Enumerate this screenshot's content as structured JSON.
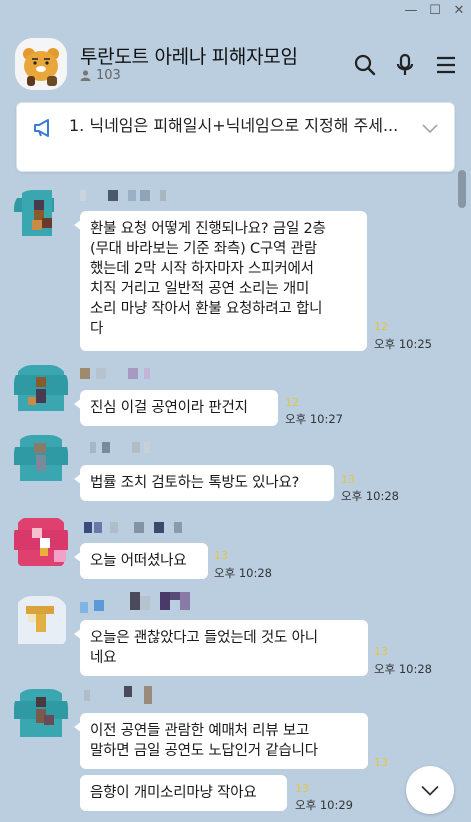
{
  "window": {
    "minimize": "—",
    "maximize": "☐",
    "close": "✕"
  },
  "header": {
    "title": "투란도트 아레나 피해자모임",
    "member_count": "103",
    "icons": [
      "search-icon",
      "microphone-icon",
      "menu-icon"
    ]
  },
  "notice": {
    "text": "1. 닉네임은 피해일시+닉네임으로 지정해 주세..."
  },
  "messages": [
    {
      "text_lines": [
        "환불 요청 어떻게 진행되나요? 금일 2층",
        "(무대 바라보는 기준 좌측)  C구역 관람",
        "했는데 2막 시작 하자마자 스피커에서",
        "치직 거리고 일반적 공연 소리는 개미",
        "소리 마냥 작아서 환불 요청하려고 합니",
        "다"
      ],
      "unread": "12",
      "time": "오후 10:25"
    },
    {
      "text": "진심 이걸 공연이라 판건지",
      "unread": "12",
      "time": "오후 10:27"
    },
    {
      "text": "법률 조치 검토하는 톡방도 있나요?",
      "unread": "13",
      "time": "오후 10:28"
    },
    {
      "text": "오늘 어떠셨나요",
      "unread": "13",
      "time": "오후 10:28"
    },
    {
      "text_lines": [
        "오늘은 괜찮았다고 들었는데 것도 아니",
        "네요"
      ],
      "unread": "13",
      "time": "오후 10:28"
    },
    {
      "text_lines": [
        "이전 공연들 관람한 예매처 리뷰 보고",
        "말하면 금일 공연도 노답인거 같습니다"
      ],
      "unread": "13",
      "time": ""
    },
    {
      "text": "음향이 개미소리마냥 작아요",
      "unread": "13",
      "time": "오후 10:29"
    }
  ],
  "colors": {
    "background": "#bacee0",
    "bubble": "#ffffff",
    "unread": "#e2c640",
    "notice_accent": "#3a7bd5"
  }
}
